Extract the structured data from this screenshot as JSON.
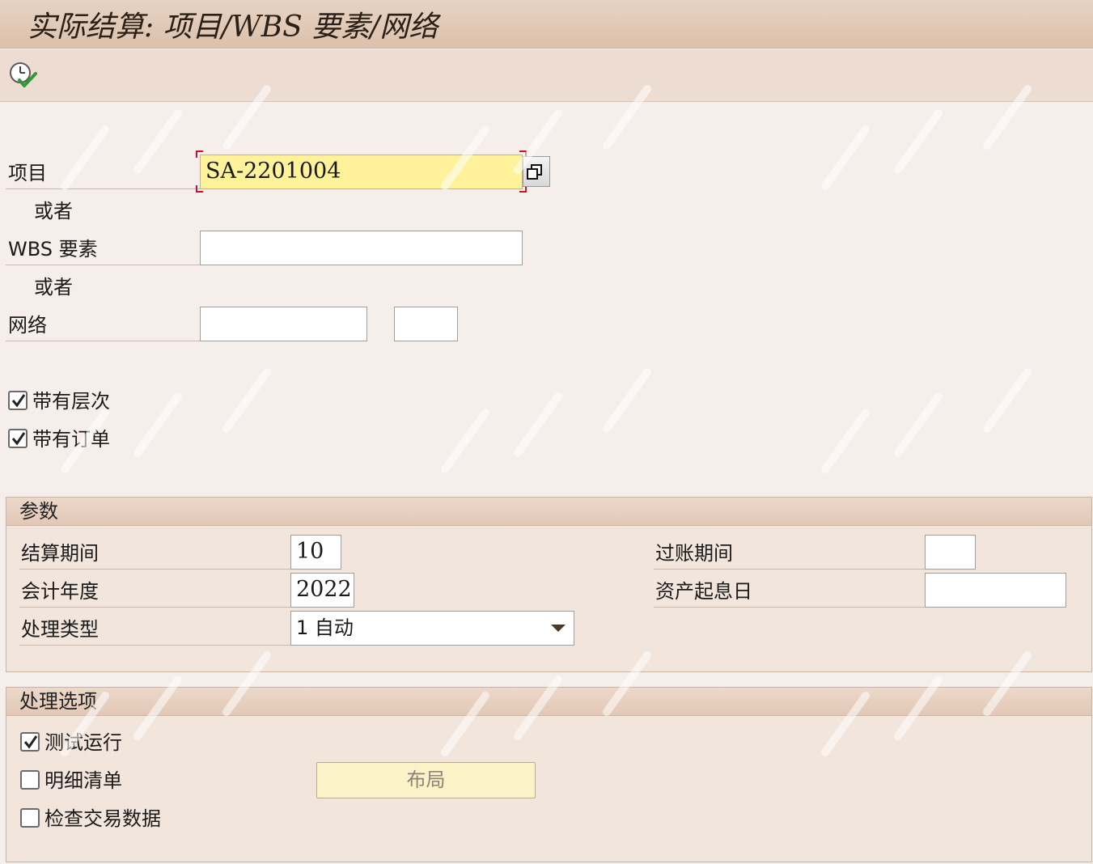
{
  "window": {
    "title": "实际结算: 项目/WBS 要素/网络"
  },
  "toolbar": {
    "execute_icon": "execute-clock-check-icon"
  },
  "selection": {
    "project_label": "项目",
    "project_value": "SA-2201004",
    "or_label_1": "或者",
    "wbs_label": "WBS 要素",
    "wbs_value": "",
    "or_label_2": "或者",
    "network_label": "网络",
    "network_value": "",
    "network_activity_value": "",
    "with_hierarchy_label": "带有层次",
    "with_hierarchy_checked": true,
    "with_orders_label": "带有订单",
    "with_orders_checked": true
  },
  "parameters": {
    "title": "参数",
    "settlement_period_label": "结算期间",
    "settlement_period_value": "10",
    "fiscal_year_label": "会计年度",
    "fiscal_year_value": "2022",
    "processing_type_label": "处理类型",
    "processing_type_value": "1 自动",
    "posting_period_label": "过账期间",
    "posting_period_value": "",
    "asset_value_date_label": "资产起息日",
    "asset_value_date_value": ""
  },
  "processing_options": {
    "title": "处理选项",
    "test_run_label": "测试运行",
    "test_run_checked": true,
    "detail_list_label": "明细清单",
    "detail_list_checked": false,
    "check_trans_label": "检查交易数据",
    "check_trans_checked": false,
    "layout_button_label": "布局"
  },
  "colors": {
    "accent_red": "#c0182a",
    "focus_yellow": "#fff29a",
    "check_green": "#2f9a35"
  }
}
